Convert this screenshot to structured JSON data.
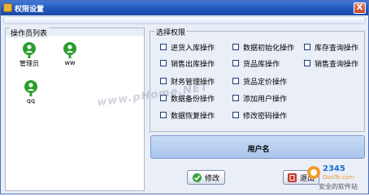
{
  "window": {
    "title": "权限设置",
    "close_label": "X"
  },
  "operators": {
    "title": "操作员列表",
    "users": [
      {
        "name": "管理员",
        "color": "#2a9d2a"
      },
      {
        "name": "ww",
        "color": "#2a9d2a"
      },
      {
        "name": "qq",
        "color": "#2a9d2a"
      }
    ]
  },
  "permissions": {
    "title": "选择权限",
    "items": [
      {
        "label": "进货入库操作",
        "checked": false
      },
      {
        "label": "数据初始化操作",
        "checked": false
      },
      {
        "label": "库存查询操作",
        "checked": false
      },
      {
        "label": "销售出库操作",
        "checked": false
      },
      {
        "label": "货品库操作",
        "checked": false
      },
      {
        "label": "销售查询操作",
        "checked": false
      },
      {
        "label": "财务管理操作",
        "checked": false
      },
      {
        "label": "货品定价操作",
        "checked": false
      },
      {
        "label": "数据备份操作",
        "checked": false
      },
      {
        "label": "添加用户操作",
        "checked": false
      },
      {
        "label": "数据恢复操作",
        "checked": false
      },
      {
        "label": "修改密码操作",
        "checked": false
      }
    ]
  },
  "selected_user_panel": {
    "label": "用户名"
  },
  "buttons": {
    "modify_label": "修改",
    "exit_label": "退出"
  },
  "watermark": {
    "text": "www.pHome.NET"
  },
  "brand": {
    "logo_text": "2345",
    "sub_text": "DuoTe.com",
    "slogan": "安全的软件站"
  },
  "colors": {
    "titlebar": "#1f55bd",
    "window_bg": "#e9eef7",
    "user_icon": "#2a9d2a",
    "user_panel": "#a9c4ec"
  }
}
